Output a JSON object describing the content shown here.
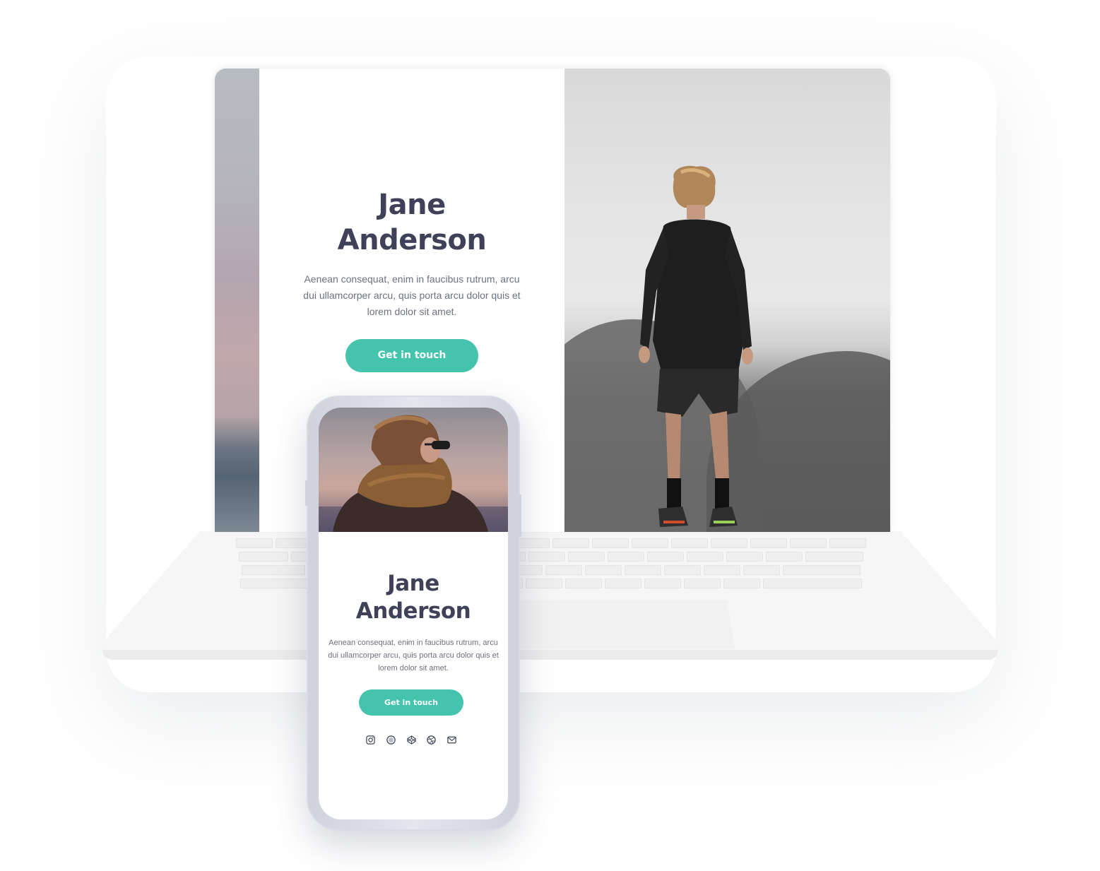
{
  "desktop": {
    "name_line1": "Jane",
    "name_line2": "Anderson",
    "description": "Aenean consequat, enim in faucibus rutrum, arcu dui ullamcorper arcu, quis porta arcu dolor quis et lorem dolor sit amet.",
    "cta_label": "Get in touch"
  },
  "mobile": {
    "name_line1": "Jane",
    "name_line2": "Anderson",
    "description": "Aenean consequat, enim in faucibus rutrum, arcu dui ullamcorper arcu, quis porta arcu dolor quis et lorem dolor sit amet.",
    "cta_label": "Get in touch",
    "social_icons": [
      "instagram-icon",
      "circle-icon",
      "codepen-icon",
      "dribbble-icon",
      "mail-icon"
    ]
  },
  "colors": {
    "accent": "#45c4ad",
    "heading": "#3e4157",
    "body_text": "#6d7080"
  }
}
